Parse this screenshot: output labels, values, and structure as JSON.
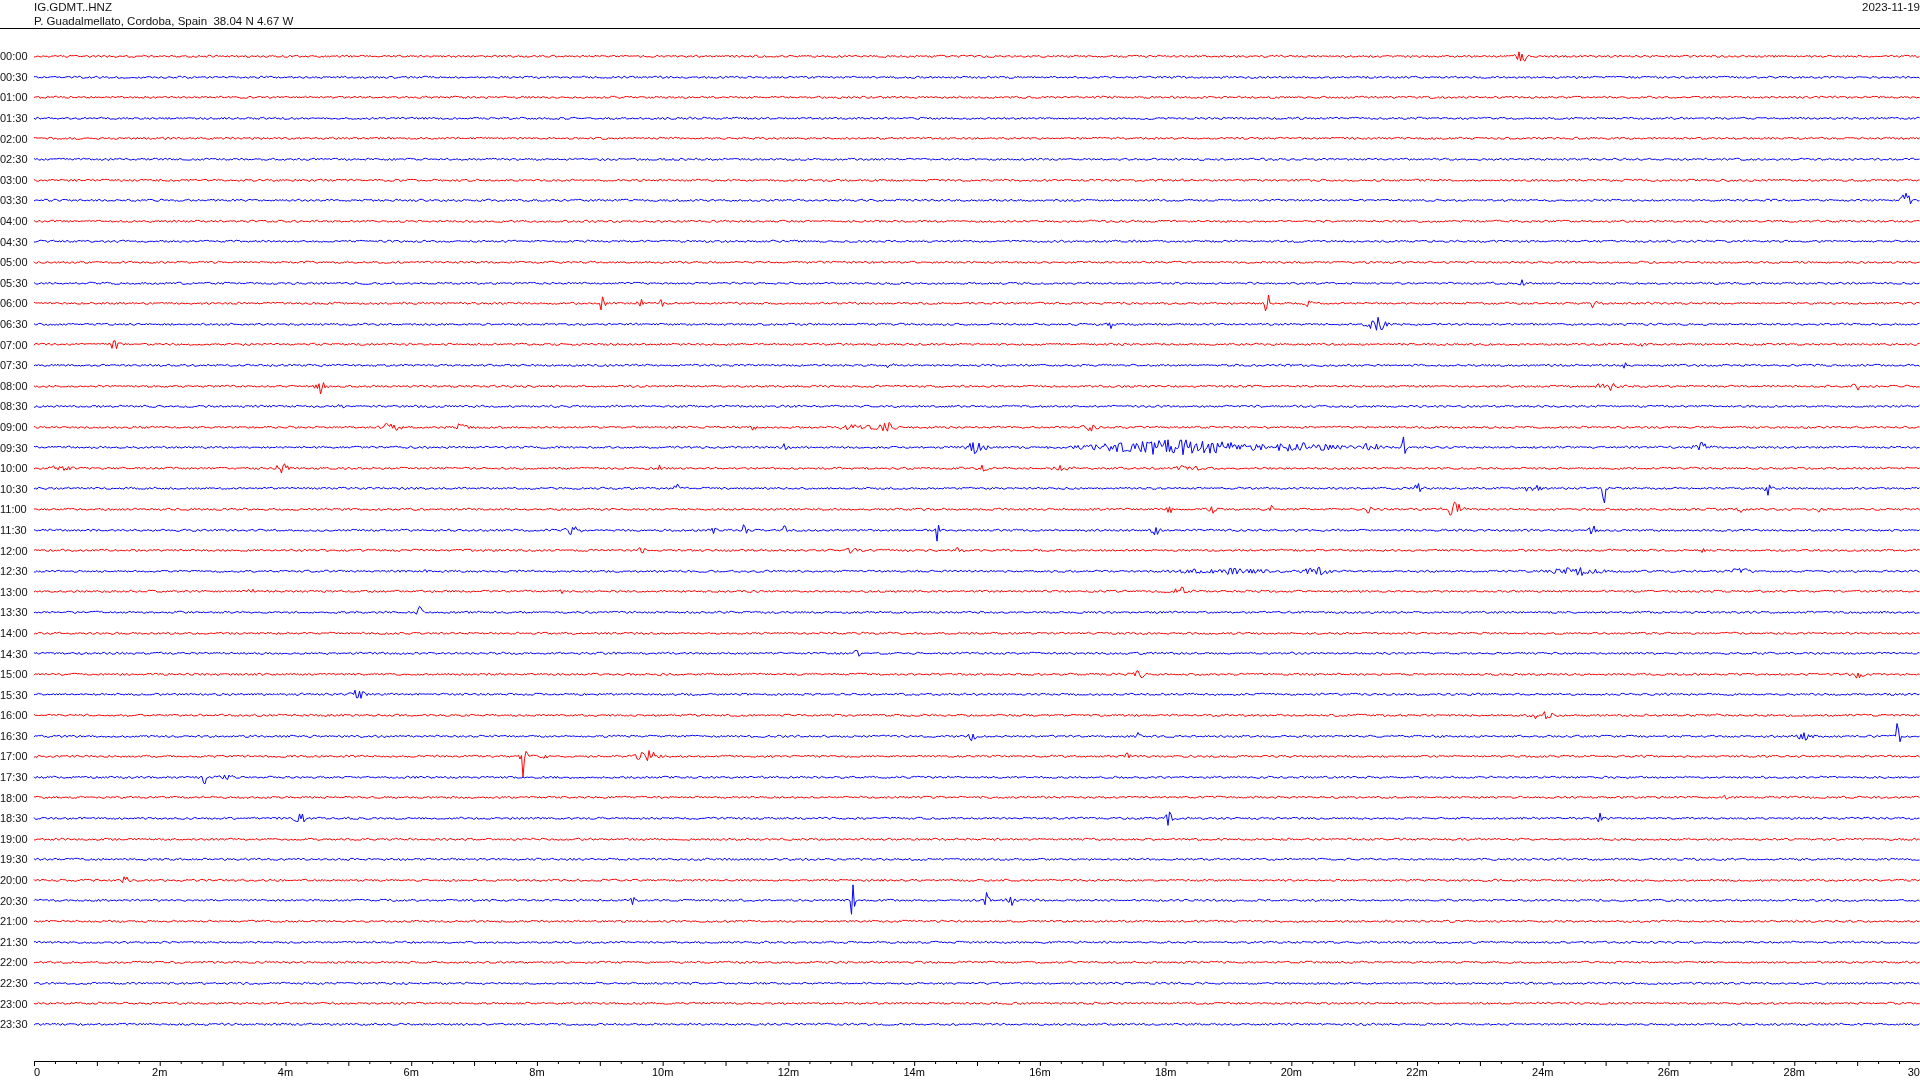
{
  "header": {
    "station": "IG.GDMT..HNZ",
    "location": "P. Guadalmellato, Cordoba, Spain  38.04 N 4.67 W",
    "date": "2023-11-19"
  },
  "rows": [
    {
      "time": "00:00",
      "color": "#ff0000"
    },
    {
      "time": "00:30",
      "color": "#0000ff"
    },
    {
      "time": "01:00",
      "color": "#ff0000"
    },
    {
      "time": "01:30",
      "color": "#0000ff"
    },
    {
      "time": "02:00",
      "color": "#ff0000"
    },
    {
      "time": "02:30",
      "color": "#0000ff"
    },
    {
      "time": "03:00",
      "color": "#ff0000"
    },
    {
      "time": "03:30",
      "color": "#0000ff"
    },
    {
      "time": "04:00",
      "color": "#ff0000"
    },
    {
      "time": "04:30",
      "color": "#0000ff"
    },
    {
      "time": "05:00",
      "color": "#ff0000"
    },
    {
      "time": "05:30",
      "color": "#0000ff"
    },
    {
      "time": "06:00",
      "color": "#ff0000"
    },
    {
      "time": "06:30",
      "color": "#0000ff"
    },
    {
      "time": "07:00",
      "color": "#ff0000"
    },
    {
      "time": "07:30",
      "color": "#0000ff"
    },
    {
      "time": "08:00",
      "color": "#ff0000"
    },
    {
      "time": "08:30",
      "color": "#0000ff"
    },
    {
      "time": "09:00",
      "color": "#ff0000"
    },
    {
      "time": "09:30",
      "color": "#0000ff"
    },
    {
      "time": "10:00",
      "color": "#ff0000"
    },
    {
      "time": "10:30",
      "color": "#0000ff"
    },
    {
      "time": "11:00",
      "color": "#ff0000"
    },
    {
      "time": "11:30",
      "color": "#0000ff"
    },
    {
      "time": "12:00",
      "color": "#ff0000"
    },
    {
      "time": "12:30",
      "color": "#0000ff"
    },
    {
      "time": "13:00",
      "color": "#ff0000"
    },
    {
      "time": "13:30",
      "color": "#0000ff"
    },
    {
      "time": "14:00",
      "color": "#ff0000"
    },
    {
      "time": "14:30",
      "color": "#0000ff"
    },
    {
      "time": "15:00",
      "color": "#ff0000"
    },
    {
      "time": "15:30",
      "color": "#0000ff"
    },
    {
      "time": "16:00",
      "color": "#ff0000"
    },
    {
      "time": "16:30",
      "color": "#0000ff"
    },
    {
      "time": "17:00",
      "color": "#ff0000"
    },
    {
      "time": "17:30",
      "color": "#0000ff"
    },
    {
      "time": "18:00",
      "color": "#ff0000"
    },
    {
      "time": "18:30",
      "color": "#0000ff"
    },
    {
      "time": "19:00",
      "color": "#ff0000"
    },
    {
      "time": "19:30",
      "color": "#0000ff"
    },
    {
      "time": "20:00",
      "color": "#ff0000"
    },
    {
      "time": "20:30",
      "color": "#0000ff"
    },
    {
      "time": "21:00",
      "color": "#ff0000"
    },
    {
      "time": "21:30",
      "color": "#0000ff"
    },
    {
      "time": "22:00",
      "color": "#ff0000"
    },
    {
      "time": "22:30",
      "color": "#0000ff"
    },
    {
      "time": "23:00",
      "color": "#ff0000"
    },
    {
      "time": "23:30",
      "color": "#0000ff"
    }
  ],
  "axis": {
    "labels": [
      "0",
      "2m",
      "4m",
      "6m",
      "8m",
      "10m",
      "12m",
      "14m",
      "16m",
      "18m",
      "20m",
      "22m",
      "24m",
      "26m",
      "28m",
      "30"
    ]
  }
}
